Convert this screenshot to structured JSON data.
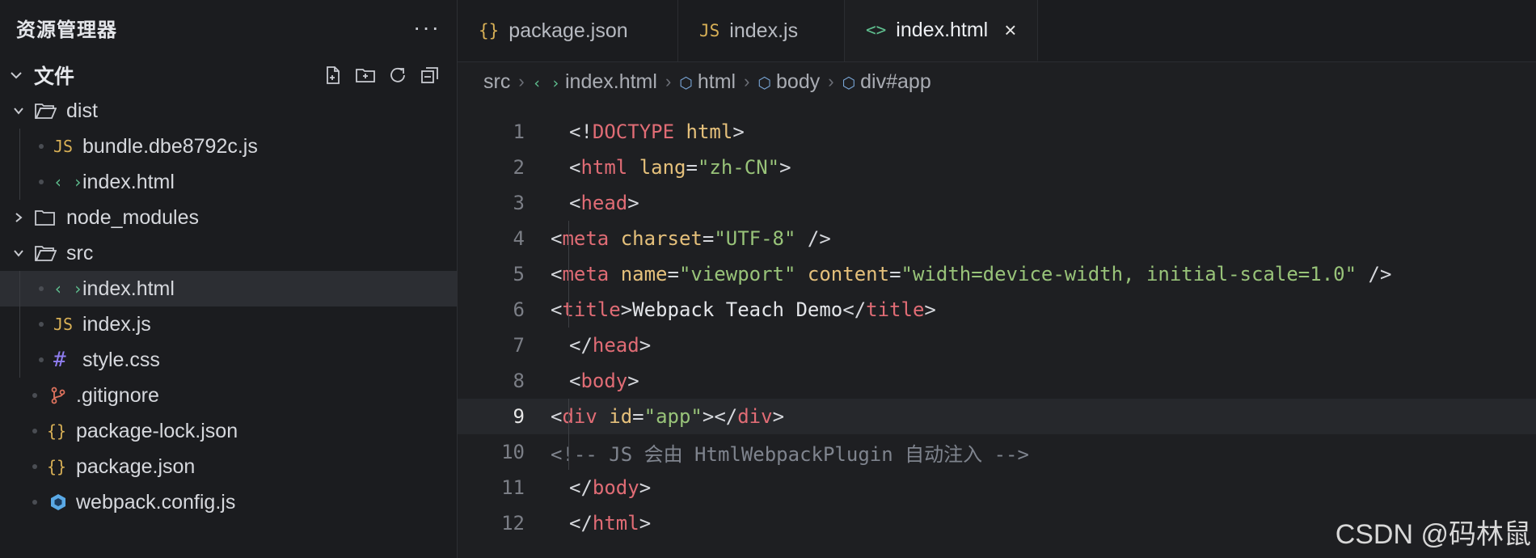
{
  "sidebar": {
    "title": "资源管理器",
    "more": "···",
    "section": "文件",
    "tree": [
      {
        "name": "dist",
        "type": "folder",
        "open": true,
        "level": 0
      },
      {
        "name": "bundle.dbe8792c.js",
        "type": "js",
        "level": 1
      },
      {
        "name": "index.html",
        "type": "html",
        "level": 1
      },
      {
        "name": "node_modules",
        "type": "folder",
        "open": false,
        "level": 0
      },
      {
        "name": "src",
        "type": "folder",
        "open": true,
        "level": 0
      },
      {
        "name": "index.html",
        "type": "html",
        "level": 1,
        "selected": true
      },
      {
        "name": "index.js",
        "type": "js",
        "level": 1
      },
      {
        "name": "style.css",
        "type": "css",
        "level": 1
      },
      {
        "name": ".gitignore",
        "type": "git",
        "level": 0
      },
      {
        "name": "package-lock.json",
        "type": "json",
        "level": 0
      },
      {
        "name": "package.json",
        "type": "json",
        "level": 0
      },
      {
        "name": "webpack.config.js",
        "type": "webpack",
        "level": 0
      }
    ]
  },
  "tabs": [
    {
      "label": "package.json",
      "icon": "{}",
      "type": "json"
    },
    {
      "label": "index.js",
      "icon": "JS",
      "type": "js"
    },
    {
      "label": "index.html",
      "icon": "<>",
      "type": "html",
      "active": true
    }
  ],
  "close_symbol": "×",
  "breadcrumb": {
    "src": "src",
    "file": "index.html",
    "html": "html",
    "body": "body",
    "div": "div#app"
  },
  "icons": {
    "js": "JS",
    "html": "‹ ›",
    "css": "#",
    "json": "{}"
  },
  "code": [
    {
      "n": "1",
      "tokens": [
        [
          "p",
          "<!"
        ],
        [
          "tag",
          "DOCTYPE"
        ],
        [
          "p",
          " "
        ],
        [
          "attr",
          "html"
        ],
        [
          "p",
          ">"
        ]
      ]
    },
    {
      "n": "2",
      "tokens": [
        [
          "p",
          "<"
        ],
        [
          "tag",
          "html"
        ],
        [
          "p",
          " "
        ],
        [
          "attr",
          "lang"
        ],
        [
          "p",
          "="
        ],
        [
          "str",
          "\"zh-CN\""
        ],
        [
          "p",
          ">"
        ]
      ]
    },
    {
      "n": "3",
      "tokens": [
        [
          "p",
          "<"
        ],
        [
          "tag",
          "head"
        ],
        [
          "p",
          ">"
        ]
      ]
    },
    {
      "n": "4",
      "indent": true,
      "tokens": [
        [
          "p",
          "<"
        ],
        [
          "tag",
          "meta"
        ],
        [
          "p",
          " "
        ],
        [
          "attr",
          "charset"
        ],
        [
          "p",
          "="
        ],
        [
          "str",
          "\"UTF-8\""
        ],
        [
          "p",
          " />"
        ]
      ]
    },
    {
      "n": "5",
      "indent": true,
      "tokens": [
        [
          "p",
          "<"
        ],
        [
          "tag",
          "meta"
        ],
        [
          "p",
          " "
        ],
        [
          "attr",
          "name"
        ],
        [
          "p",
          "="
        ],
        [
          "str",
          "\"viewport\""
        ],
        [
          "p",
          " "
        ],
        [
          "attr",
          "content"
        ],
        [
          "p",
          "="
        ],
        [
          "str",
          "\"width=device-width, initial-scale=1.0\""
        ],
        [
          "p",
          " />"
        ]
      ]
    },
    {
      "n": "6",
      "indent": true,
      "tokens": [
        [
          "p",
          "<"
        ],
        [
          "tag",
          "title"
        ],
        [
          "p",
          ">"
        ],
        [
          "plain",
          "Webpack Teach Demo"
        ],
        [
          "p",
          "</"
        ],
        [
          "tag",
          "title"
        ],
        [
          "p",
          ">"
        ]
      ]
    },
    {
      "n": "7",
      "tokens": [
        [
          "p",
          "</"
        ],
        [
          "tag",
          "head"
        ],
        [
          "p",
          ">"
        ]
      ]
    },
    {
      "n": "8",
      "tokens": [
        [
          "p",
          "<"
        ],
        [
          "tag",
          "body"
        ],
        [
          "p",
          ">"
        ]
      ]
    },
    {
      "n": "9",
      "indent": true,
      "current": true,
      "tokens": [
        [
          "p",
          "<"
        ],
        [
          "tag",
          "div"
        ],
        [
          "p",
          " "
        ],
        [
          "attr",
          "id"
        ],
        [
          "p",
          "="
        ],
        [
          "str",
          "\"app\""
        ],
        [
          "p",
          "></"
        ],
        [
          "tag",
          "div"
        ],
        [
          "p",
          ">"
        ]
      ]
    },
    {
      "n": "10",
      "indent": true,
      "tokens": [
        [
          "cmt",
          "<!-- JS 会由 HtmlWebpackPlugin 自动注入 -->"
        ]
      ]
    },
    {
      "n": "11",
      "tokens": [
        [
          "p",
          "</"
        ],
        [
          "tag",
          "body"
        ],
        [
          "p",
          ">"
        ]
      ]
    },
    {
      "n": "12",
      "tokens": [
        [
          "p",
          "</"
        ],
        [
          "tag",
          "html"
        ],
        [
          "p",
          ">"
        ]
      ]
    }
  ],
  "watermark": "CSDN @码林鼠"
}
